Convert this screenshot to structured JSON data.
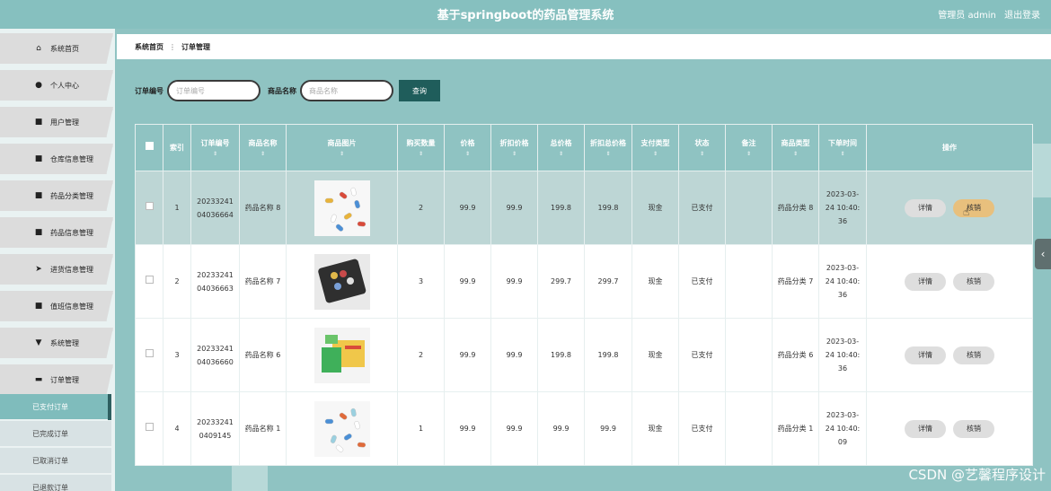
{
  "header": {
    "title": "基于springboot的药品管理系统",
    "user": "管理员 admin",
    "logout": "退出登录"
  },
  "sidebar": {
    "items": [
      {
        "icon": "home-icon",
        "glyph": "⌂",
        "label": "系统首页"
      },
      {
        "icon": "person-icon",
        "glyph": "●",
        "label": "个人中心"
      },
      {
        "icon": "user-manage-icon",
        "glyph": "■",
        "label": "用户管理"
      },
      {
        "icon": "grid-icon",
        "glyph": "■",
        "label": "仓库信息管理"
      },
      {
        "icon": "grid-icon",
        "glyph": "■",
        "label": "药品分类管理"
      },
      {
        "icon": "grid-icon",
        "glyph": "■",
        "label": "药品信息管理"
      },
      {
        "icon": "send-icon",
        "glyph": "➤",
        "label": "进货信息管理"
      },
      {
        "icon": "grid-icon",
        "glyph": "■",
        "label": "值班信息管理"
      },
      {
        "icon": "system-icon",
        "glyph": "▼",
        "label": "系统管理"
      },
      {
        "icon": "order-icon",
        "glyph": "▬",
        "label": "订单管理"
      }
    ],
    "subitems": [
      {
        "label": "已支付订单",
        "active": true
      },
      {
        "label": "已完成订单",
        "active": false
      },
      {
        "label": "已取消订单",
        "active": false
      },
      {
        "label": "已退款订单",
        "active": false
      }
    ]
  },
  "breadcrumb": {
    "home": "系统首页",
    "sep": "⋮",
    "current": "订单管理"
  },
  "search": {
    "order_no_label": "订单编号",
    "order_no_placeholder": "订单编号",
    "name_label": "商品名称",
    "name_placeholder": "商品名称",
    "button": "查询"
  },
  "table": {
    "columns": [
      "索引",
      "订单编号",
      "商品名称",
      "商品图片",
      "购买数量",
      "价格",
      "折扣价格",
      "总价格",
      "折扣总价格",
      "支付类型",
      "状态",
      "备注",
      "商品类型",
      "下单时间",
      "操作"
    ],
    "rows": [
      {
        "index": "1",
        "order_no": "20233241 04036664",
        "name": "药品名称 8",
        "qty": "2",
        "price": "99.9",
        "discount_price": "99.9",
        "total": "199.8",
        "discount_total": "199.8",
        "pay_type": "现金",
        "status": "已支付",
        "remark": "",
        "category": "药品分类 8",
        "time": "2023-03- 24 10:40: 36"
      },
      {
        "index": "2",
        "order_no": "20233241 04036663",
        "name": "药品名称 7",
        "qty": "3",
        "price": "99.9",
        "discount_price": "99.9",
        "total": "299.7",
        "discount_total": "299.7",
        "pay_type": "现金",
        "status": "已支付",
        "remark": "",
        "category": "药品分类 7",
        "time": "2023-03- 24 10:40: 36"
      },
      {
        "index": "3",
        "order_no": "20233241 04036660",
        "name": "药品名称 6",
        "qty": "2",
        "price": "99.9",
        "discount_price": "99.9",
        "total": "199.8",
        "discount_total": "199.8",
        "pay_type": "现金",
        "status": "已支付",
        "remark": "",
        "category": "药品分类 6",
        "time": "2023-03- 24 10:40: 36"
      },
      {
        "index": "4",
        "order_no": "20233241 0409145",
        "name": "药品名称 1",
        "qty": "1",
        "price": "99.9",
        "discount_price": "99.9",
        "total": "99.9",
        "discount_total": "99.9",
        "pay_type": "现金",
        "status": "已支付",
        "remark": "",
        "category": "药品分类 1",
        "time": "2023-03- 24 10:40: 09"
      }
    ],
    "actions": {
      "detail": "详情",
      "verify": "核销"
    }
  },
  "watermark": "CSDN @艺馨程序设计",
  "colors": {
    "header": "#86c0bf",
    "accent": "#1f5d5b",
    "active_sub": "#7fbcbc",
    "highlight_row": "#bdd6d5"
  }
}
